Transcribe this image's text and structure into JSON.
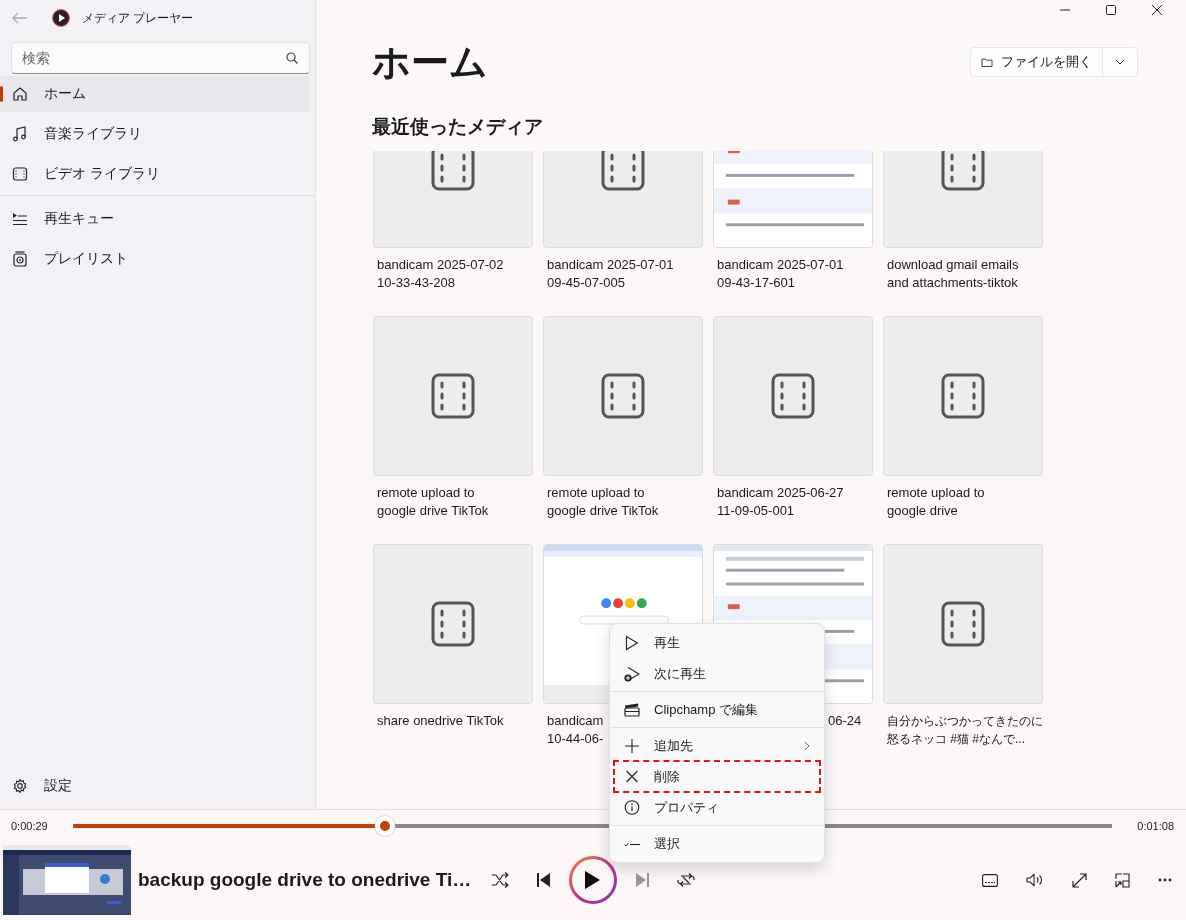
{
  "window": {
    "title": "メディア プレーヤー"
  },
  "search": {
    "placeholder": "検索"
  },
  "nav_groups": [
    [
      {
        "label": "ホーム",
        "selected": true
      },
      {
        "label": "音楽ライブラリ",
        "selected": false
      },
      {
        "label": "ビデオ ライブラリ",
        "selected": false
      }
    ],
    [
      {
        "label": "再生キュー",
        "selected": false
      },
      {
        "label": "プレイリスト",
        "selected": false
      }
    ]
  ],
  "settings": {
    "label": "設定"
  },
  "page_title": "ホーム",
  "open_file": {
    "label": "ファイルを開く"
  },
  "section_title": "最近使ったメディア",
  "media": [
    {
      "kind": "placeholder",
      "title_lines": [
        "bandicam 2025-07-02",
        "10-33-43-208"
      ]
    },
    {
      "kind": "placeholder",
      "title_lines": [
        "bandicam 2025-07-01",
        "09-45-07-005"
      ]
    },
    {
      "kind": "picture",
      "title_lines": [
        "bandicam 2025-07-01",
        "09-43-17-601"
      ]
    },
    {
      "kind": "placeholder",
      "title_lines": [
        "download gmail emails",
        "and attachments-tiktok"
      ]
    },
    {
      "kind": "placeholder",
      "title_lines": [
        "remote upload to",
        "google drive TikTok"
      ]
    },
    {
      "kind": "placeholder",
      "title_lines": [
        "remote upload to",
        "google drive TikTok"
      ]
    },
    {
      "kind": "placeholder",
      "title_lines": [
        "bandicam 2025-06-27",
        "11-09-05-001"
      ]
    },
    {
      "kind": "placeholder",
      "title_lines": [
        "remote upload to",
        "google drive"
      ]
    },
    {
      "kind": "placeholder",
      "title_lines": [
        "share onedrive TikTok"
      ]
    },
    {
      "kind": "picture",
      "title_lines": [
        "bandicam",
        "10-44-06-"
      ]
    },
    {
      "kind": "picture",
      "title_lines": [
        "06-24"
      ],
      "title_clipped_left": true
    },
    {
      "kind": "placeholder",
      "title_lines": [
        "自分からぶつかってきたのに",
        "怒るネッコ #猫 #なんで..."
      ]
    }
  ],
  "context_menu": {
    "groups": [
      [
        {
          "label": "再生",
          "submenu": false,
          "marked": false
        },
        {
          "label": "次に再生",
          "submenu": false,
          "marked": false
        }
      ],
      [
        {
          "label": "Clipchamp で編集",
          "submenu": false,
          "marked": false
        }
      ],
      [
        {
          "label": "追加先",
          "submenu": true,
          "marked": false
        },
        {
          "label": "削除",
          "submenu": false,
          "marked": true
        },
        {
          "label": "プロパティ",
          "submenu": false,
          "marked": false
        }
      ],
      [
        {
          "label": "選択",
          "submenu": false,
          "marked": false
        }
      ]
    ]
  },
  "player": {
    "elapsed": "0:00:29",
    "total": "0:01:08",
    "level": 0.3,
    "title": "backup google drive to onedrive Ti…",
    "next_disabled": true
  }
}
